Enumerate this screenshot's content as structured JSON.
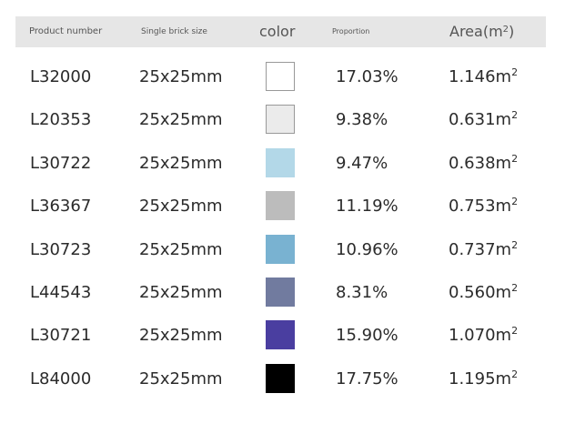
{
  "headers": {
    "product_number": "Product number",
    "single_brick_size": "Single brick size",
    "color": "color",
    "proportion": "Proportion",
    "area": "Area(m",
    "area_sup": "2",
    "area_close": ")"
  },
  "unit_sup": "2",
  "rows": [
    {
      "product": "L32000",
      "size": "25x25mm",
      "color": "#ffffff",
      "border": "#999999",
      "proportion": "17.03%",
      "area": "1.146m"
    },
    {
      "product": "L20353",
      "size": "25x25mm",
      "color": "#ebebeb",
      "border": "#999999",
      "proportion": "9.38%",
      "area": "0.631m"
    },
    {
      "product": "L30722",
      "size": "25x25mm",
      "color": "#b3d8e8",
      "border": "none",
      "proportion": "9.47%",
      "area": "0.638m"
    },
    {
      "product": "L36367",
      "size": "25x25mm",
      "color": "#bcbcbc",
      "border": "none",
      "proportion": "11.19%",
      "area": "0.753m"
    },
    {
      "product": "L30723",
      "size": "25x25mm",
      "color": "#79b2d1",
      "border": "none",
      "proportion": "10.96%",
      "area": "0.737m"
    },
    {
      "product": "L44543",
      "size": "25x25mm",
      "color": "#717b9f",
      "border": "none",
      "proportion": "8.31%",
      "area": "0.560m"
    },
    {
      "product": "L30721",
      "size": "25x25mm",
      "color": "#4a3ea0",
      "border": "none",
      "proportion": "15.90%",
      "area": "1.070m"
    },
    {
      "product": "L84000",
      "size": "25x25mm",
      "color": "#000000",
      "border": "none",
      "proportion": "17.75%",
      "area": "1.195m"
    }
  ]
}
